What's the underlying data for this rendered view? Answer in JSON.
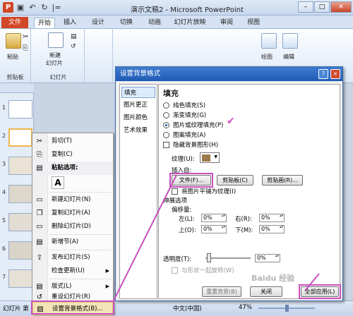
{
  "window": {
    "title": "演示文稿2 - Microsoft PowerPoint",
    "qat_sep": "|="
  },
  "tabs": [
    "文件",
    "开始",
    "插入",
    "设计",
    "切换",
    "动画",
    "幻灯片放映",
    "审阅",
    "视图"
  ],
  "ribbon": {
    "paste": "粘贴",
    "new_slide_line1": "新建",
    "new_slide_line2": "幻灯片",
    "clipboard_group": "剪贴板",
    "slides_group": "幻灯片",
    "drawing": "绘图",
    "editing": "编辑"
  },
  "slides": [
    {
      "num": "1"
    },
    {
      "num": "2"
    },
    {
      "num": "3"
    },
    {
      "num": "4"
    },
    {
      "num": "5"
    },
    {
      "num": "6"
    },
    {
      "num": "7"
    },
    {
      "num": "8"
    },
    {
      "num": "9"
    },
    {
      "num": "10"
    }
  ],
  "context_menu": {
    "items": [
      {
        "label": "剪切(T)",
        "icon": "scissors-icon"
      },
      {
        "label": "复制(C)",
        "icon": "copy-icon"
      },
      {
        "label": "粘贴选项:",
        "icon": "paste-icon"
      },
      {
        "label": "A",
        "icon": ""
      },
      {
        "label": "新建幻灯片(N)",
        "icon": "new-slide-icon"
      },
      {
        "label": "复制幻灯片(A)",
        "icon": "duplicate-slide-icon"
      },
      {
        "label": "删除幻灯片(D)",
        "icon": "delete-slide-icon"
      },
      {
        "label": "新增节(A)",
        "icon": "new-section-icon"
      },
      {
        "label": "发布幻灯片(S)",
        "icon": "publish-icon"
      },
      {
        "label": "检查更新(U)",
        "icon": ""
      },
      {
        "label": "版式(L)",
        "icon": "layout-icon"
      },
      {
        "label": "重设幻灯片(R)",
        "icon": "reset-icon"
      },
      {
        "label": "设置背景格式(B)...",
        "icon": "background-icon"
      }
    ]
  },
  "dialog": {
    "title": "设置背景格式",
    "help": "?",
    "close": "×",
    "nav": [
      "填充",
      "图片更正",
      "图片颜色",
      "艺术效果"
    ],
    "heading": "填充",
    "options": [
      "纯色填充(S)",
      "渐变填充(G)",
      "图片或纹理填充(P)",
      "图案填充(A)"
    ],
    "hide_bg": "隐藏背景图形(H)",
    "texture_label": "纹理(U):",
    "insert_from": "插入自:",
    "btn_file": "文件(F)...",
    "btn_clipboard": "剪贴板(C)",
    "btn_clipart": "剪贴画(R)...",
    "tile": "将图片平铺为纹理(I)",
    "stretch": "伸展选项",
    "offset": "偏移量:",
    "left": "左(L):",
    "right": "右(R):",
    "top": "上(O):",
    "bottom": "下(M):",
    "left_val": "0%",
    "right_val": "0%",
    "top_val": "0%",
    "bottom_val": "0%",
    "transparency": "透明度(T):",
    "transparency_val": "0%",
    "rotate_with_shape": "与形状一起旋转(W)",
    "btn_reset": "重置背景(B)",
    "btn_close": "关闭",
    "btn_apply_all": "全部应用(L)"
  },
  "statusbar": {
    "slide": "幻灯片 第",
    "lang": "中文(中国)",
    "zoom": "47%"
  },
  "watermark": "Baidu 经验"
}
